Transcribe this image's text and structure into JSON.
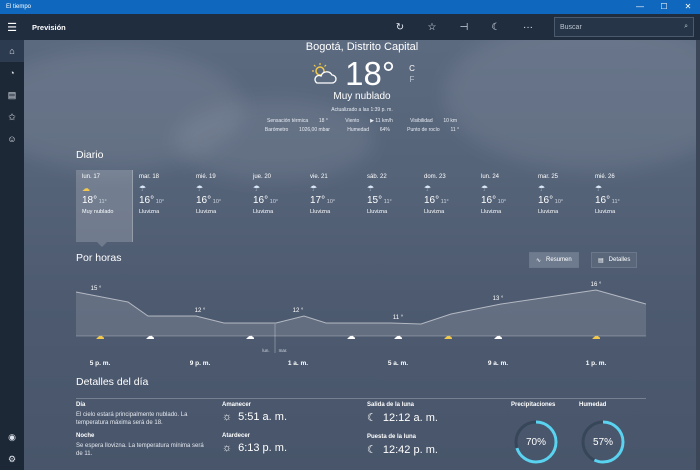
{
  "window": {
    "title": "El tiempo",
    "minimize": "—",
    "maximize": "☐",
    "close": "✕"
  },
  "cmdbar": {
    "page_title": "Previsión",
    "search_placeholder": "Buscar",
    "more": "···"
  },
  "header": {
    "city": "Bogotá, Distrito Capital",
    "temp": "18°",
    "unit_c": "C",
    "unit_f": "F",
    "condition": "Muy nublado",
    "updated": "Actualizado a las 1:39 p. m.",
    "stats_line1": [
      {
        "label": "Sensación térmica",
        "value": "18 °"
      },
      {
        "label": "Viento",
        "value": "▶ 11 km/h"
      },
      {
        "label": "Visibilidad",
        "value": "10 km"
      }
    ],
    "stats_line2": [
      {
        "label": "Barómetro",
        "value": "1026,00 mbar"
      },
      {
        "label": "Humedad",
        "value": "64%"
      },
      {
        "label": "Punto de rocío",
        "value": "11 °"
      }
    ]
  },
  "daily": {
    "title": "Diario",
    "days": [
      {
        "name": "lun. 17",
        "hi": "18°",
        "lo": "11°",
        "desc": "Muy nublado"
      },
      {
        "name": "mar. 18",
        "hi": "16°",
        "lo": "10°",
        "desc": "Lluvizna"
      },
      {
        "name": "mié. 19",
        "hi": "16°",
        "lo": "10°",
        "desc": "Lluvizna"
      },
      {
        "name": "jue. 20",
        "hi": "16°",
        "lo": "10°",
        "desc": "Lluvizna"
      },
      {
        "name": "vie. 21",
        "hi": "17°",
        "lo": "10°",
        "desc": "Lluvizna"
      },
      {
        "name": "sáb. 22",
        "hi": "15°",
        "lo": "11°",
        "desc": "Lluvizna"
      },
      {
        "name": "dom. 23",
        "hi": "16°",
        "lo": "11°",
        "desc": "Lluvizna"
      },
      {
        "name": "lun. 24",
        "hi": "16°",
        "lo": "10°",
        "desc": "Lluvizna"
      },
      {
        "name": "mar. 25",
        "hi": "16°",
        "lo": "10°",
        "desc": "Lluvizna"
      },
      {
        "name": "mié. 26",
        "hi": "16°",
        "lo": "11°",
        "desc": "Lluvizna"
      }
    ]
  },
  "hourly": {
    "title": "Por horas",
    "btn_summary": "Resumen",
    "btn_details": "Detalles",
    "temp_labels": [
      "15 °",
      "12 °",
      "12 °",
      "11 °",
      "13 °",
      "16 °"
    ],
    "time_labels": [
      "5 p. m.",
      "9 p. m.",
      "1 a. m.",
      "5 a. m.",
      "9 a. m.",
      "1 p. m."
    ],
    "day_labels": [
      "lun.",
      "mar."
    ]
  },
  "details": {
    "title": "Detalles del día",
    "day_label": "Día",
    "day_text": "El cielo estará principalmente nublado. La temperatura máxima será de 18.",
    "night_label": "Noche",
    "night_text": "Se espera lloviznа. La temperatura mínima será de 11.",
    "sunrise_label": "Amanecer",
    "sunrise": "5:51 a. m.",
    "sunset_label": "Atardecer",
    "sunset": "6:13 p. m.",
    "moonrise_label": "Salida de la luna",
    "moonrise": "12:12 a. m.",
    "moonset_label": "Puesta de la luna",
    "moonset": "12:42 p. m.",
    "precip_label": "Precipitaciones",
    "precip": "70%",
    "precip_value": 0.7,
    "humidity_label": "Humedad",
    "humidity": "57%",
    "humidity_value": 0.57
  },
  "colors": {
    "accent": "#0f68bd",
    "ring": "#5ad3f0",
    "ring_track": "#38465a"
  }
}
